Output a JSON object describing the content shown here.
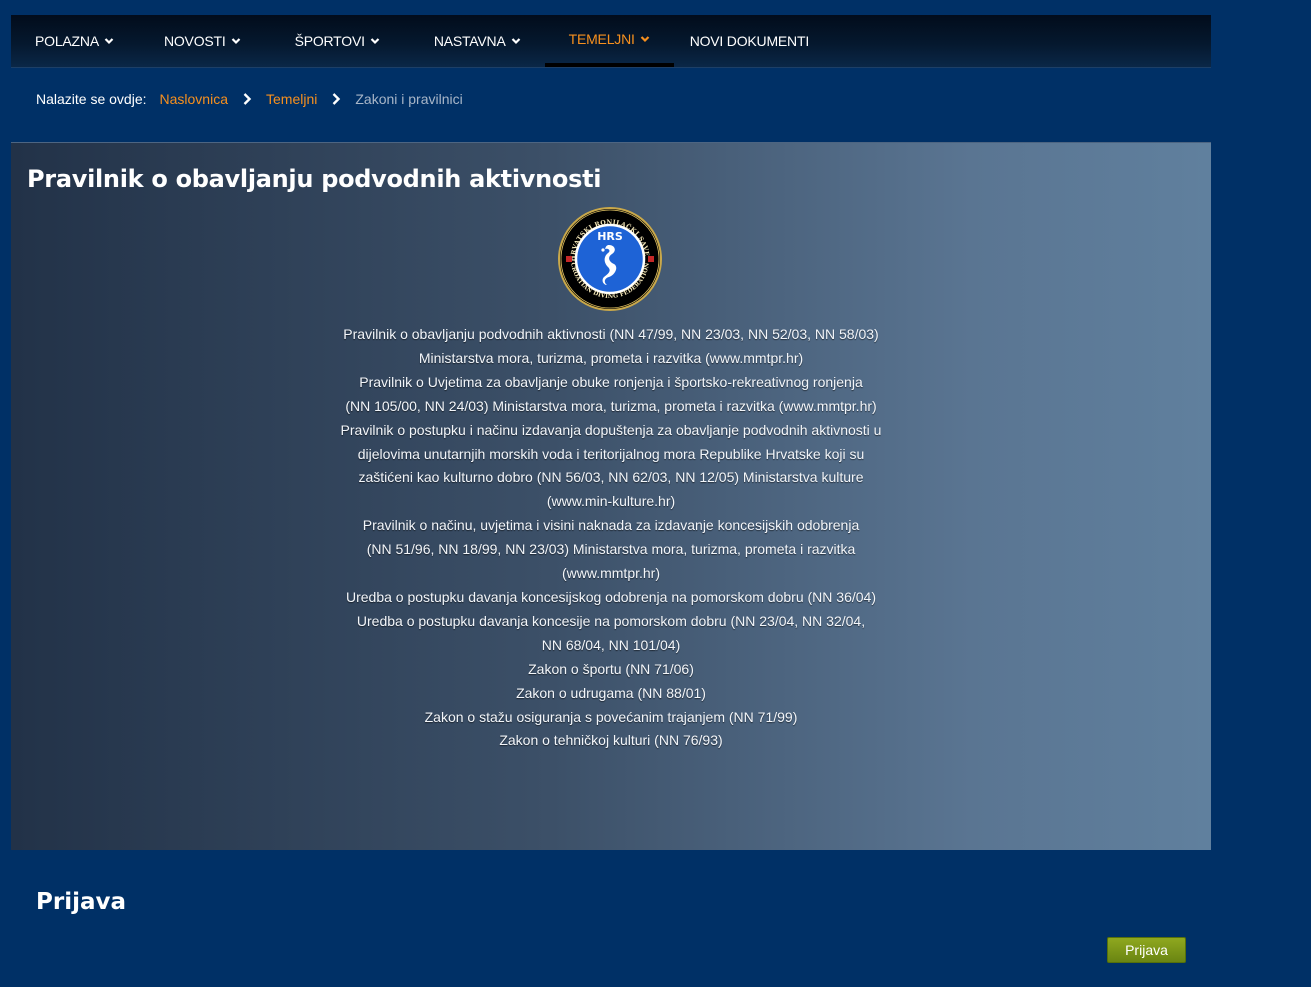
{
  "nav": {
    "items": [
      {
        "label": "POLAZNA",
        "active": false
      },
      {
        "label": "NOVOSTI",
        "active": false
      },
      {
        "label": "ŠPORTOVI",
        "active": false
      },
      {
        "label": "NASTAVNA",
        "active": false
      },
      {
        "label": "TEMELJNI",
        "active": true
      },
      {
        "label": "NOVI DOKUMENTI",
        "active": false
      }
    ],
    "chevron_icon": "chevron-down-icon"
  },
  "breadcrumb": {
    "prefix": "Nalazite se ovdje:",
    "items": [
      "Naslovnica",
      "Temeljni"
    ],
    "current": "Zakoni i pravilnici",
    "separator_icon": "chevron-right-icon"
  },
  "article": {
    "title": "Pravilnik o obavljanju podvodnih aktivnosti",
    "logo": {
      "abbr": "HRS",
      "ring_top": "HRVATSKI RONILAČKI SAVEZ",
      "ring_bottom": "CROATIAN DIVING FEDERATION"
    },
    "lines": [
      "Pravilnik o obavljanju podvodnih aktivnosti (NN 47/99, NN 23/03, NN 52/03, NN 58/03)",
      "Ministarstva mora, turizma, prometa i razvitka (www.mmtpr.hr)",
      "Pravilnik o Uvjetima za obavljanje obuke ronjenja i športsko-rekreativnog ronjenja",
      "(NN 105/00, NN 24/03) Ministarstva mora, turizma, prometa i razvitka (www.mmtpr.hr)",
      "Pravilnik o postupku i načinu izdavanja dopuštenja za obavljanje podvodnih aktivnosti u",
      "dijelovima unutarnjih morskih voda i teritorijalnog mora Republike Hrvatske koji su",
      "zaštićeni kao kulturno dobro (NN 56/03, NN 62/03, NN 12/05) Ministarstva kulture",
      "(www.min-kulture.hr)",
      "Pravilnik o načinu, uvjetima i visini naknada za izdavanje koncesijskih odobrenja",
      "(NN 51/96, NN 18/99, NN 23/03) Ministarstva mora, turizma, prometa i razvitka",
      "(www.mmtpr.hr)",
      "Uredba o postupku davanja koncesijskog odobrenja na pomorskom dobru (NN 36/04)",
      "Uredba o postupku davanja koncesije na pomorskom dobru (NN 23/04, NN 32/04,",
      "NN 68/04, NN 101/04)",
      "Zakon o športu (NN 71/06)",
      "Zakon o udrugama (NN 88/01)",
      "Zakon o stažu osiguranja s povećanim trajanjem (NN 71/99)",
      "Zakon o tehničkoj kulturi (NN 76/93)"
    ]
  },
  "login": {
    "title": "Prijava",
    "button_label": "Prijava"
  },
  "colors": {
    "background": "#003066",
    "accent": "#f7901e",
    "button": "#7a9418"
  }
}
